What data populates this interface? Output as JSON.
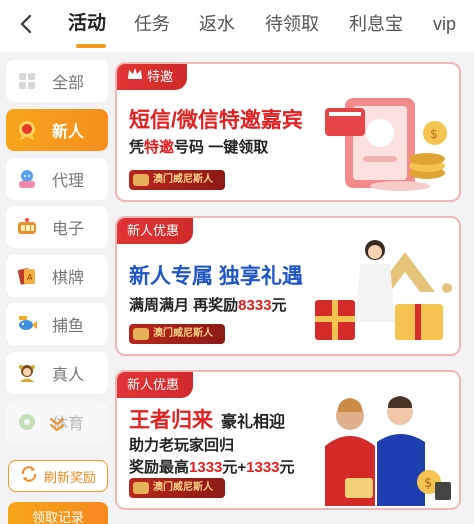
{
  "tabs": [
    {
      "label": "活动",
      "active": true
    },
    {
      "label": "任务",
      "active": false
    },
    {
      "label": "返水",
      "active": false
    },
    {
      "label": "待领取",
      "active": false
    },
    {
      "label": "利息宝",
      "active": false
    },
    {
      "label": "vip",
      "active": false
    }
  ],
  "sidebar": {
    "items": [
      {
        "label": "全部",
        "icon": "grid-icon"
      },
      {
        "label": "新人",
        "icon": "medal-icon",
        "active": true
      },
      {
        "label": "代理",
        "icon": "agent-icon"
      },
      {
        "label": "电子",
        "icon": "slot-machine-icon"
      },
      {
        "label": "棋牌",
        "icon": "cards-icon"
      },
      {
        "label": "捕鱼",
        "icon": "fish-icon"
      },
      {
        "label": "真人",
        "icon": "live-dealer-icon"
      },
      {
        "label": "体育",
        "icon": "soccer-icon"
      }
    ],
    "refresh_label": "刷新奖励",
    "record_label": "领取记录"
  },
  "cards": [
    {
      "tag": "特邀",
      "headline": "短信/微信特邀嘉宾",
      "sub_pre": "凭",
      "sub_highlight": "特邀",
      "sub_post": "号码  一键领取",
      "brand": "澳门威尼斯人"
    },
    {
      "tag": "新人优惠",
      "headline": "新人专属 独享礼遇",
      "sub_pre": "满周满月 再奖励",
      "sub_highlight": "8333",
      "sub_post": "元",
      "brand": "澳门威尼斯人"
    },
    {
      "tag": "新人优惠",
      "headline_red": "王者归来",
      "headline_dark": "豪礼相迎",
      "line1": "助力老玩家回归",
      "line2_pre": "奖励最高",
      "line2_a": "1333",
      "line2_mid": "元+",
      "line2_b": "1333",
      "line2_post": "元",
      "brand": "澳门威尼斯人"
    }
  ],
  "colors": {
    "accent": "#f59a1b",
    "promo_red": "#e51f1f",
    "promo_blue": "#1e56c8"
  }
}
